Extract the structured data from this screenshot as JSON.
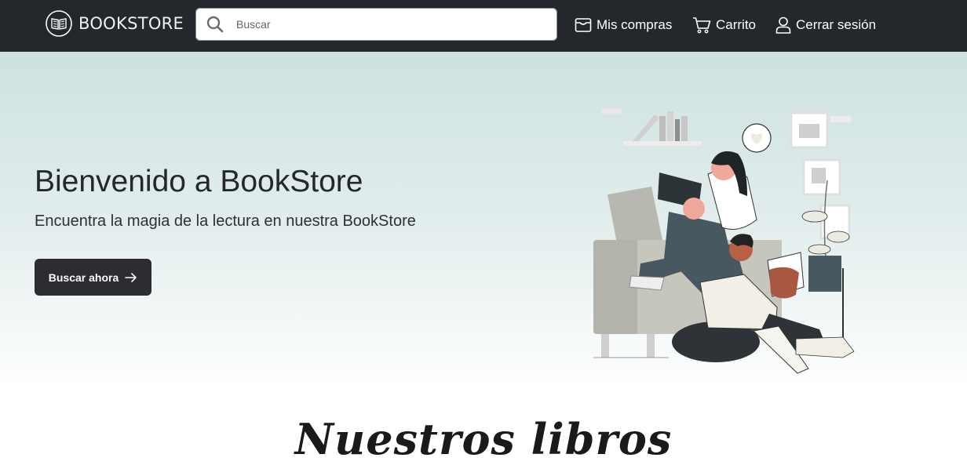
{
  "header": {
    "brand": "BOOKSTORE",
    "search": {
      "placeholder": "Buscar"
    },
    "nav": {
      "purchases": "Mis compras",
      "cart": "Carrito",
      "logout": "Cerrar sesión"
    }
  },
  "hero": {
    "title": "Bienvenido a BookStore",
    "subtitle": "Encuentra la magia de la lectura en nuestra BookStore",
    "cta_label": "Buscar ahora"
  },
  "section": {
    "title": "Nuestros libros"
  },
  "icons": [
    "book-logo-icon",
    "search-icon",
    "purchases-box-icon",
    "cart-icon",
    "user-icon",
    "arrow-right-icon"
  ],
  "colors": {
    "header_bg": "#24272b",
    "hero_top": "#cde1df",
    "button_bg": "#2b2d33"
  }
}
